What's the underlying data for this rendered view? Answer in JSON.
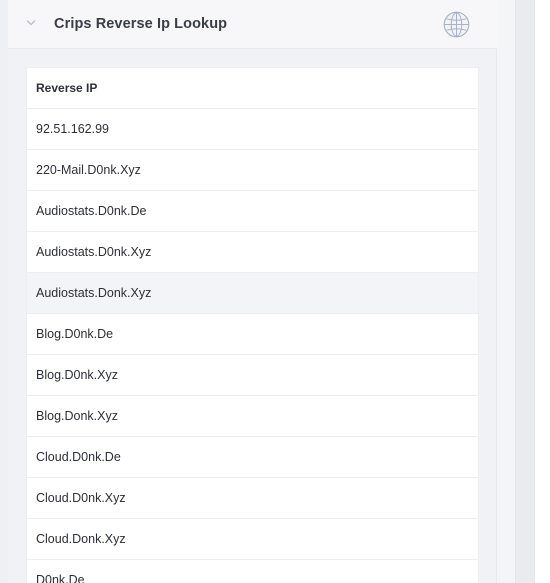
{
  "panel": {
    "title": "Crips Reverse Ip Lookup",
    "collapse_icon": "chevron-down-icon",
    "globe_icon": "globe-icon"
  },
  "table": {
    "header": "Reverse IP",
    "rows": [
      "92.51.162.99",
      "220-Mail.D0nk.Xyz",
      "Audiostats.D0nk.De",
      "Audiostats.D0nk.Xyz",
      "Audiostats.Donk.Xyz",
      "Blog.D0nk.De",
      "Blog.D0nk.Xyz",
      "Blog.Donk.Xyz",
      "Cloud.D0nk.De",
      "Cloud.D0nk.Xyz",
      "Cloud.Donk.Xyz",
      "D0nk.De"
    ]
  },
  "colors": {
    "title_text": "#3a3d45",
    "row_text": "#2c2f36",
    "hover_row": "#f3f4f7",
    "globe_stroke": "#aab3c3"
  }
}
